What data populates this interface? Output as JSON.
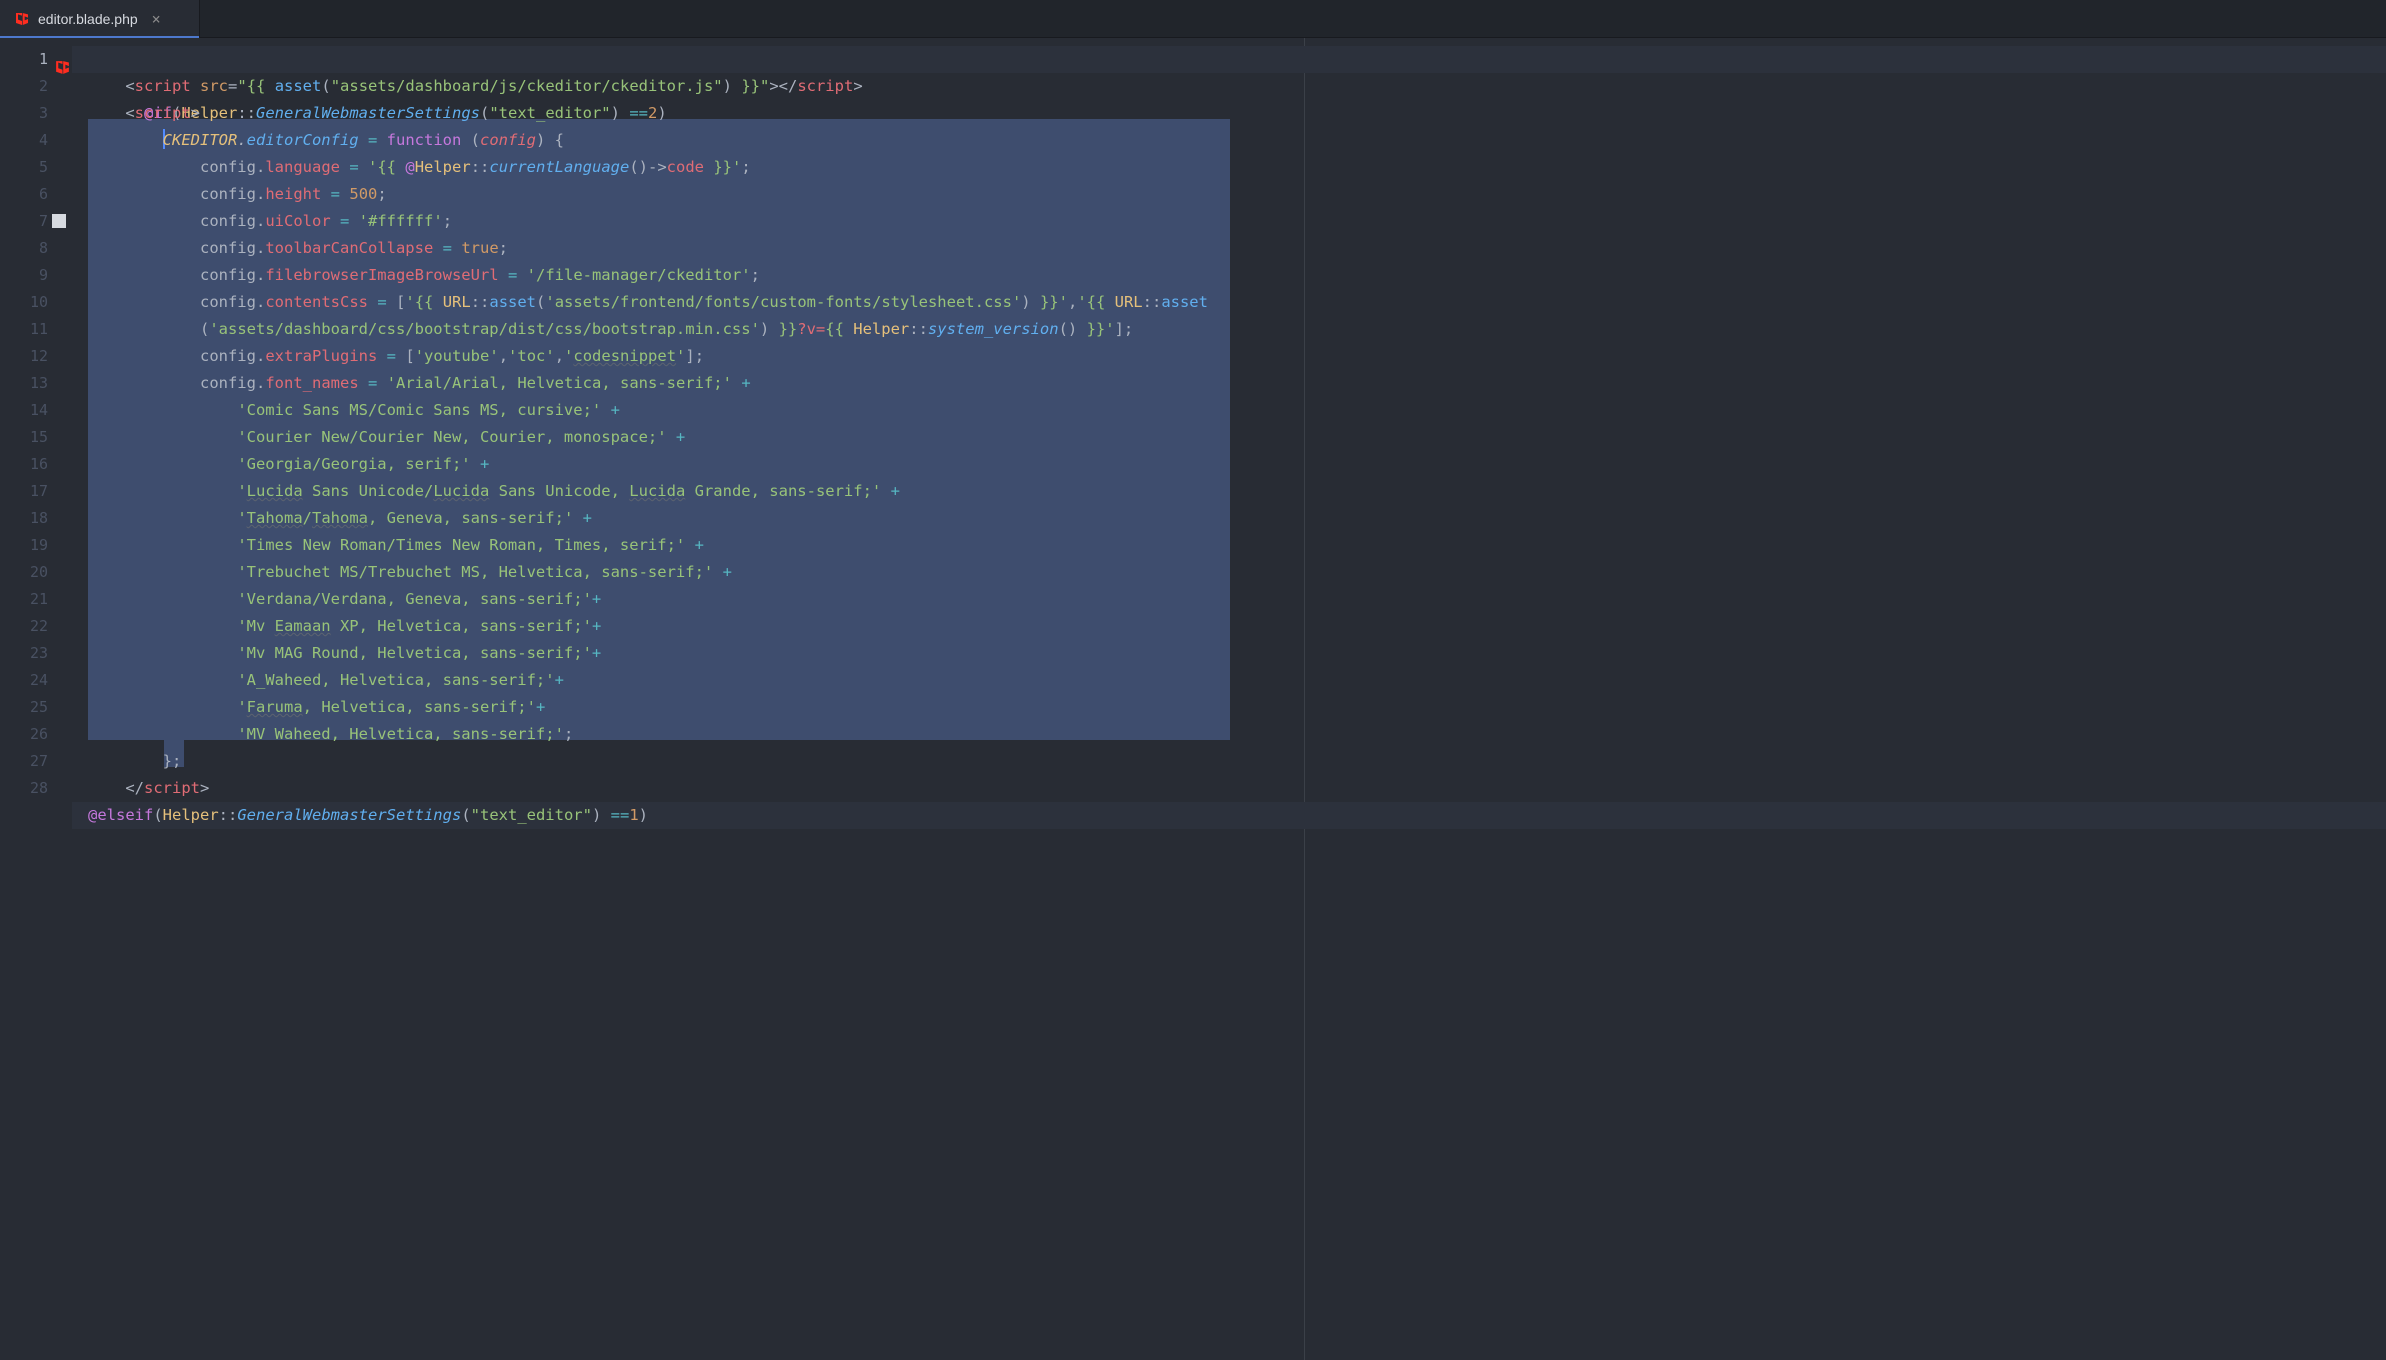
{
  "tab": {
    "filename": "editor.blade.php",
    "close_glyph": "×"
  },
  "gutter": {
    "lines": [
      "1",
      "2",
      "3",
      "4",
      "5",
      "6",
      "7",
      "8",
      "9",
      "10",
      "11",
      "12",
      "13",
      "14",
      "15",
      "16",
      "17",
      "18",
      "19",
      "20",
      "21",
      "22",
      "23",
      "24",
      "25",
      "26",
      "27",
      "28"
    ],
    "current_line": 1,
    "modified_lines": [
      7
    ]
  },
  "colors": {
    "bg": "#282c34",
    "selection": "#3e4d6e",
    "accent": "#4d78cc"
  },
  "code": {
    "l1": {
      "at_if": "@if",
      "helper": "Helper",
      "method": "GeneralWebmasterSettings",
      "arg": "\"text_editor\"",
      "cmp": "==",
      "val": "2"
    },
    "l2": {
      "tag": "script",
      "attr": "src",
      "asset_fn": "asset",
      "asset_path": "\"assets/dashboard/js/ckeditor/ckeditor.js\""
    },
    "l3": {
      "tag": "script"
    },
    "l4": {
      "obj": "CKEDITOR",
      "prop": "editorConfig",
      "fn_kw": "function",
      "param": "config"
    },
    "l5": {
      "obj": "config",
      "prop": "language",
      "prefix": "'{{ ",
      "at": "@",
      "helper": "Helper",
      "method": "currentLanguage",
      "arrow": "()->",
      "field": "code",
      "suffix": " }}'"
    },
    "l6": {
      "obj": "config",
      "prop": "height",
      "val": "500"
    },
    "l7": {
      "obj": "config",
      "prop": "uiColor",
      "val": "'#ffffff'"
    },
    "l8": {
      "obj": "config",
      "prop": "toolbarCanCollapse",
      "val": "true"
    },
    "l9": {
      "obj": "config",
      "prop": "filebrowserImageBrowseUrl",
      "val": "'/file-manager/ckeditor'"
    },
    "l10": {
      "obj": "config",
      "prop": "contentsCss",
      "url": "URL",
      "asset_fn": "asset",
      "path1": "'assets/frontend/fonts/custom-fonts/stylesheet.css'"
    },
    "l10b": {
      "path2": "'assets/dashboard/css/bootstrap/dist/css/bootstrap.min.css'",
      "query": "?v=",
      "helper": "Helper",
      "method": "system_version"
    },
    "l11": {
      "obj": "config",
      "prop": "extraPlugins",
      "v1": "'youtube'",
      "v2": "'toc'",
      "v3": "codesnippet"
    },
    "l12": {
      "obj": "config",
      "prop": "font_names",
      "val": "'Arial/Arial, Helvetica, sans-serif;'"
    },
    "l13": {
      "val": "'Comic Sans MS/Comic Sans MS, cursive;'"
    },
    "l14": {
      "val": "'Courier New/Courier New, Courier, monospace;'"
    },
    "l15": {
      "val": "'Georgia/Georgia, serif;'"
    },
    "l16": {
      "p1": "Lucida",
      "p2": " Sans Unicode/",
      "p3": "Lucida",
      "p4": " Sans Unicode, ",
      "p5": "Lucida",
      "p6": " Grande, sans-serif;'"
    },
    "l17": {
      "p1": "Tahoma",
      "p2": "/",
      "p3": "Tahoma",
      "p4": ", Geneva, sans-serif;'"
    },
    "l18": {
      "val": "'Times New Roman/Times New Roman, Times, serif;'"
    },
    "l19": {
      "val": "'Trebuchet MS/Trebuchet MS, Helvetica, sans-serif;'"
    },
    "l20": {
      "val": "'Verdana/Verdana, Geneva, sans-serif;'"
    },
    "l21": {
      "p1": "'Mv ",
      "p2": "Eamaan",
      "p3": " XP, Helvetica, sans-serif;'"
    },
    "l22": {
      "val": "'Mv MAG Round, Helvetica, sans-serif;'"
    },
    "l23": {
      "val": "'A_Waheed, Helvetica, sans-serif;'"
    },
    "l24": {
      "p1": "Faruma",
      "p2": ", Helvetica, sans-serif;'"
    },
    "l25": {
      "val": "'MV Waheed, Helvetica, sans-serif;'"
    },
    "l27": {
      "tag": "script"
    },
    "l28": {
      "at": "@elseif",
      "helper": "Helper",
      "method": "GeneralWebmasterSettings",
      "arg": "\"text_editor\"",
      "cmp": "==",
      "val": "1"
    }
  }
}
